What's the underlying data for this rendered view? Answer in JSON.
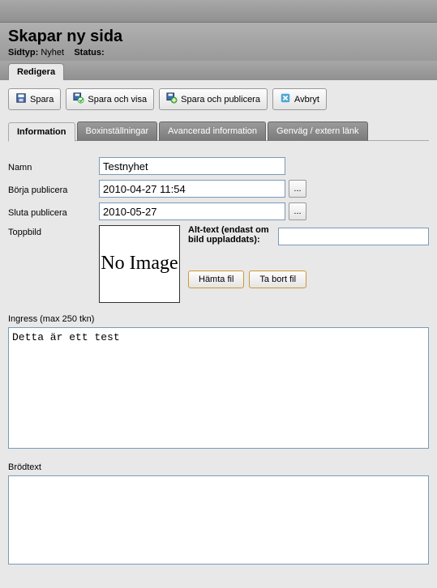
{
  "header": {
    "page_title": "Skapar ny sida",
    "sidtyp_label": "Sidtyp:",
    "sidtyp_value": "Nyhet",
    "status_label": "Status:",
    "status_value": ""
  },
  "main_tab": {
    "label": "Redigera"
  },
  "toolbar": {
    "save": "Spara",
    "save_show": "Spara och visa",
    "save_publish": "Spara och publicera",
    "cancel": "Avbryt"
  },
  "subtabs": [
    {
      "label": "Information",
      "active": true
    },
    {
      "label": "Boxinställningar",
      "active": false
    },
    {
      "label": "Avancerad information",
      "active": false
    },
    {
      "label": "Genväg / extern länk",
      "active": false
    }
  ],
  "form": {
    "name_label": "Namn",
    "name_value": "Testnyhet",
    "start_label": "Börja publicera",
    "start_value": "2010-04-27 11:54",
    "end_label": "Sluta publicera",
    "end_value": "2010-05-27",
    "picker_label": "...",
    "topimage_label": "Toppbild",
    "noimage_text": "No Image",
    "alt_label": "Alt-text (endast om bild uppladdats):",
    "alt_value": "",
    "fetch_file": "Hämta fil",
    "remove_file": "Ta bort fil",
    "ingress_label": "Ingress (max 250 tkn)",
    "ingress_value": "Detta är ett test",
    "body_label": "Brödtext",
    "body_value": ""
  }
}
